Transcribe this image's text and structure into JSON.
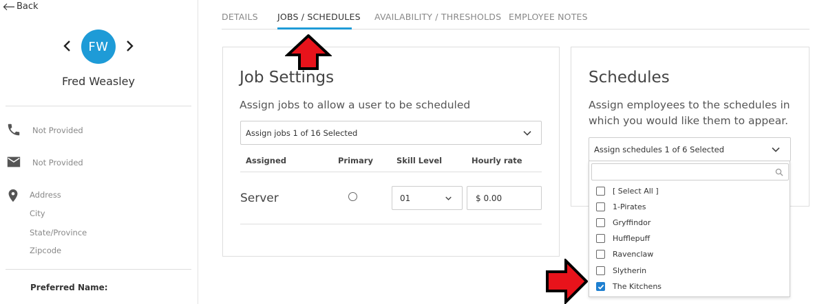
{
  "left": {
    "back_label": "Back",
    "avatar_initials": "FW",
    "employee_name": "Fred Weasley",
    "phone": "Not Provided",
    "email": "Not Provided",
    "address": "Address",
    "city": "City",
    "state": "State/Province",
    "zip": "Zipcode",
    "preferred_name_label": "Preferred Name:"
  },
  "tabs": [
    {
      "label": "DETAILS",
      "active": false
    },
    {
      "label": "JOBS / SCHEDULES",
      "active": true
    },
    {
      "label": "AVAILABILITY / THRESHOLDS",
      "active": false
    },
    {
      "label": "EMPLOYEE NOTES",
      "active": false
    }
  ],
  "accent_color": "#1e9bd7",
  "job_settings": {
    "title": "Job Settings",
    "subtitle": "Assign jobs to allow a user to be scheduled",
    "assign_select": "Assign jobs 1 of 16 Selected",
    "headers": {
      "assigned": "Assigned",
      "primary": "Primary",
      "skill": "Skill Level",
      "rate": "Hourly rate"
    },
    "rows": [
      {
        "job": "Server",
        "primary": false,
        "skill": "01",
        "rate": "$ 0.00"
      }
    ]
  },
  "schedules": {
    "title": "Schedules",
    "subtitle_line1": "Assign employees to the schedules in",
    "subtitle_line2": "which you would like them to appear.",
    "assign_select": "Assign schedules 1 of 6 Selected",
    "search_placeholder": "",
    "options": [
      {
        "label": "[ Select All ]",
        "checked": false
      },
      {
        "label": "1-Pirates",
        "checked": false
      },
      {
        "label": "Gryffindor",
        "checked": false
      },
      {
        "label": "Hufflepuff",
        "checked": false
      },
      {
        "label": "Ravenclaw",
        "checked": false
      },
      {
        "label": "Slytherin",
        "checked": false
      },
      {
        "label": "The Kitchens",
        "checked": true
      }
    ]
  }
}
